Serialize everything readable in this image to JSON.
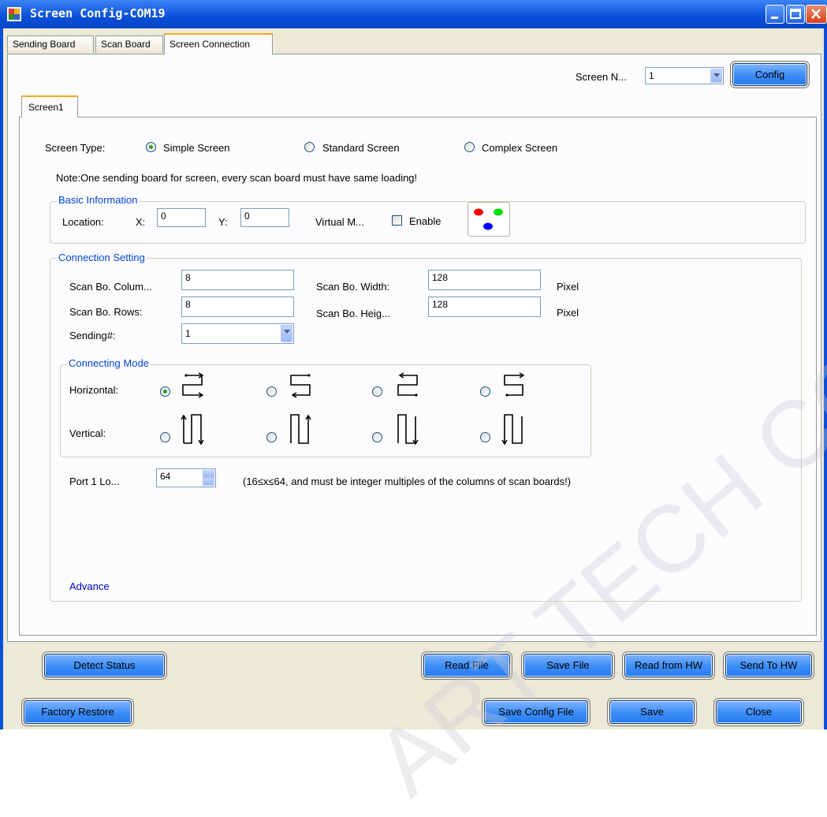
{
  "window": {
    "title": "Screen Config-COM19"
  },
  "tabs": [
    "Sending Board",
    "Scan Board",
    "Screen Connection"
  ],
  "header": {
    "screen_num_label": "Screen N...",
    "screen_num_value": "1",
    "config_button": "Config"
  },
  "screen_tab": "Screen1",
  "screen_type": {
    "label": "Screen Type:",
    "options": [
      "Simple Screen",
      "Standard Screen",
      "Complex Screen"
    ],
    "selected": "Simple Screen"
  },
  "note": "Note:One sending board for screen, every scan board must have same loading!",
  "basic_info": {
    "title": "Basic Information",
    "location_label": "Location:",
    "x_label": "X:",
    "x_value": "0",
    "y_label": "Y:",
    "y_value": "0",
    "virtual_label": "Virtual M...",
    "enable_label": "Enable",
    "enable_checked": false,
    "virtual_dot_colors": [
      "#ff0000",
      "#00dd00",
      "#0000ff"
    ]
  },
  "connection": {
    "title": "Connection Setting",
    "cols_label": "Scan Bo. Colum...",
    "cols_value": "8",
    "width_label": "Scan Bo. Width:",
    "width_value": "128",
    "rows_label": "Scan Bo. Rows:",
    "rows_value": "8",
    "height_label": "Scan Bo. Heig...",
    "height_value": "128",
    "pixel_unit": "Pixel",
    "sending_label": "Sending#:",
    "sending_value": "1"
  },
  "connecting_mode": {
    "title": "Connecting Mode",
    "horizontal_label": "Horizontal:",
    "vertical_label": "Vertical:",
    "selected": "horizontal-1"
  },
  "port": {
    "label": "Port 1 Lo...",
    "value": "64",
    "hint": "(16≤x≤64, and must be integer multiples of the columns of scan boards!)"
  },
  "advance_link": "Advance",
  "buttons_row1": {
    "detect": "Detect Status",
    "read_file": "Read File",
    "save_file": "Save File",
    "read_hw": "Read from HW",
    "send_hw": "Send To HW"
  },
  "buttons_row2": {
    "factory": "Factory Restore",
    "save_config": "Save Config File",
    "save": "Save",
    "close": "Close"
  },
  "watermark": "ART TECH CO., LT"
}
